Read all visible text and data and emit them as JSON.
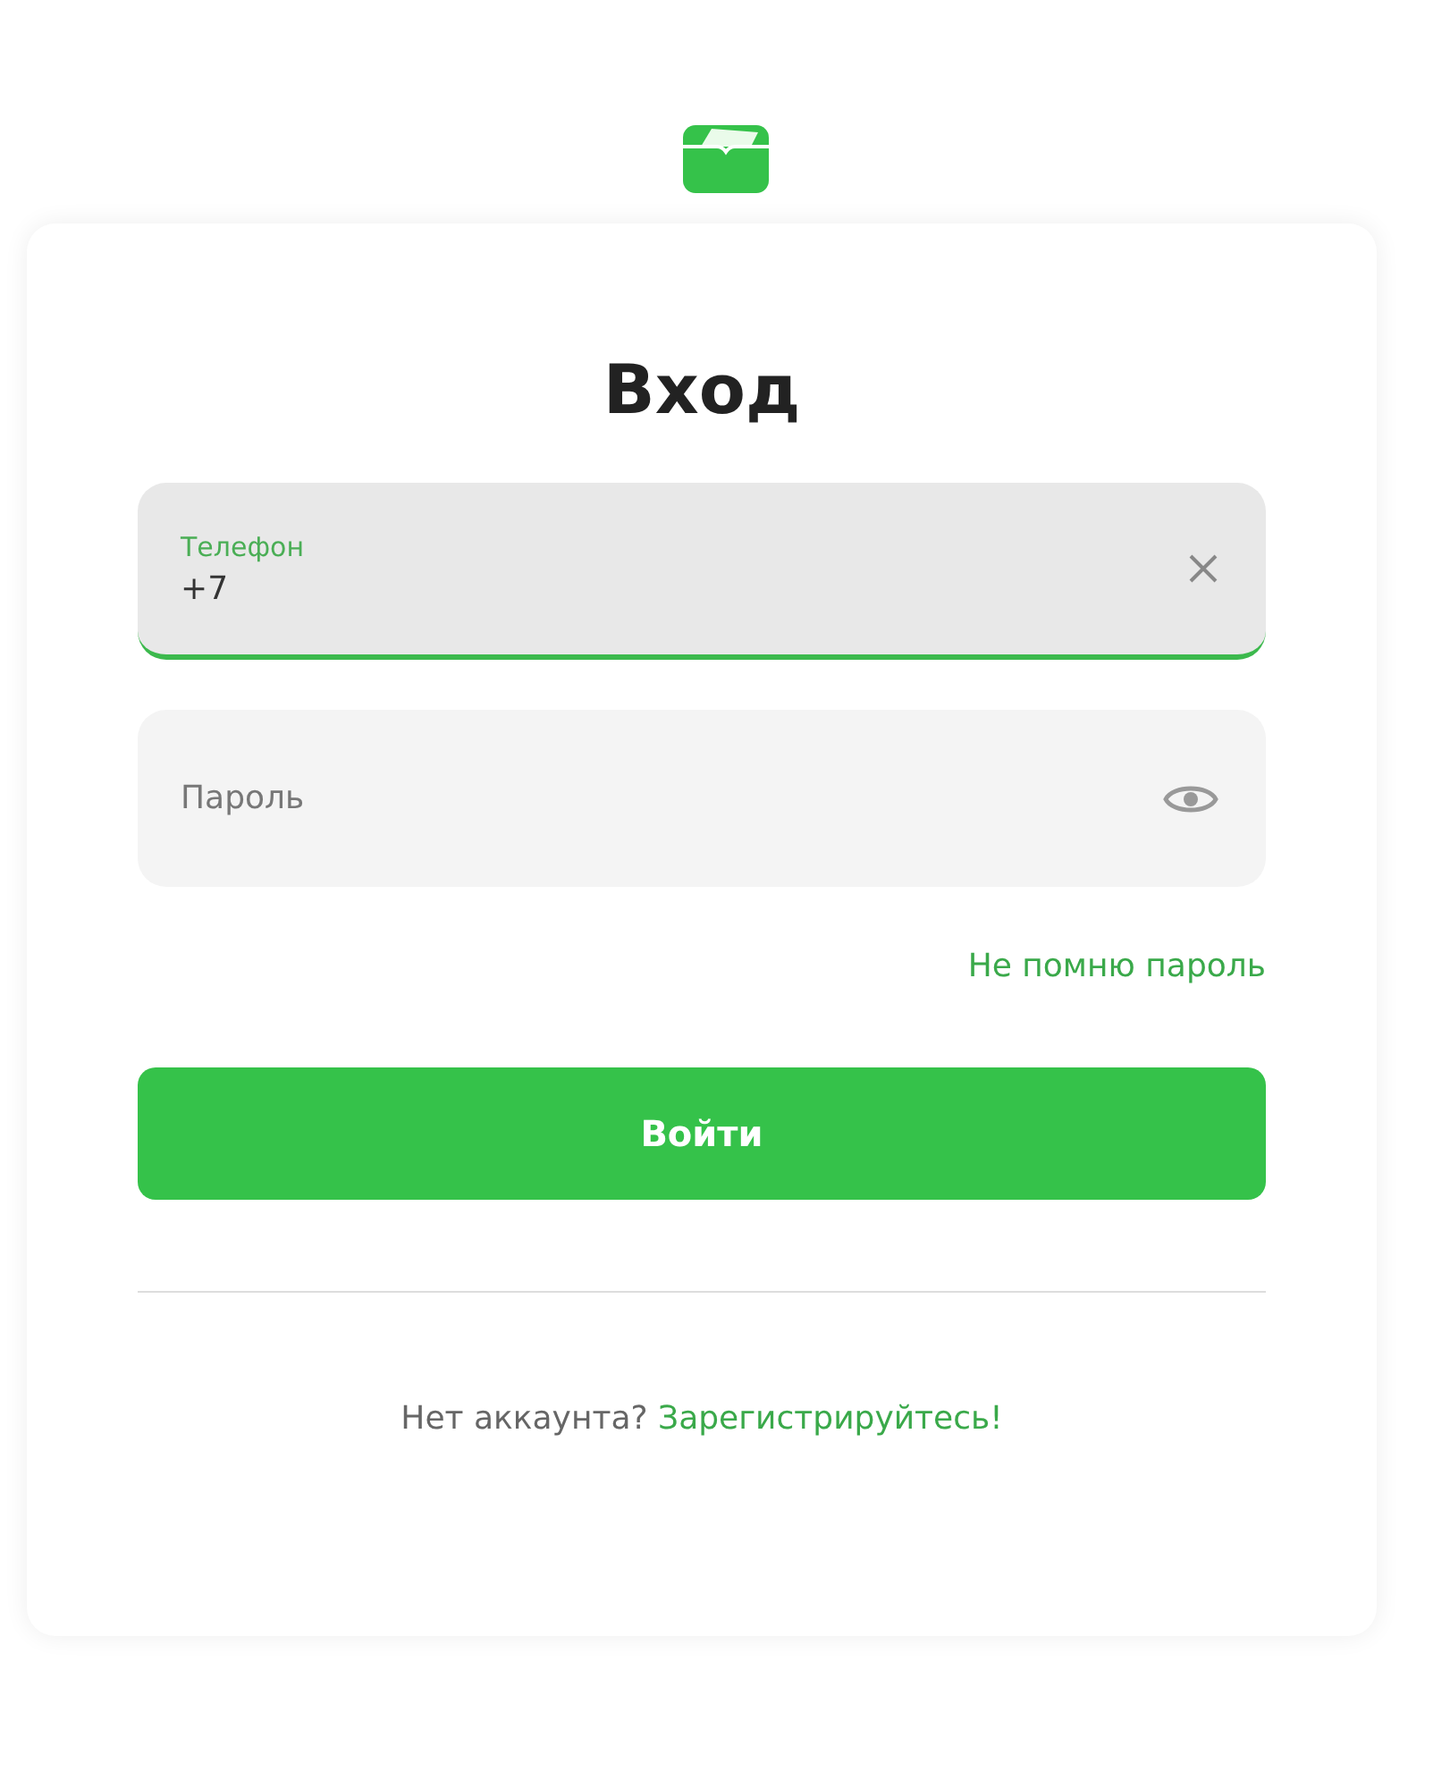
{
  "title": "Вход",
  "fields": [
    {
      "kind": "phone",
      "label": "Телефон",
      "value": "+7",
      "focused": true
    },
    {
      "kind": "password",
      "placeholder": "Пароль",
      "focused": false
    }
  ],
  "forgot_link": "Не помню пароль",
  "submit_button": "Войти",
  "footer": {
    "text": "Нет аккаунта?",
    "link": "Зарегистрируйтесь!"
  }
}
